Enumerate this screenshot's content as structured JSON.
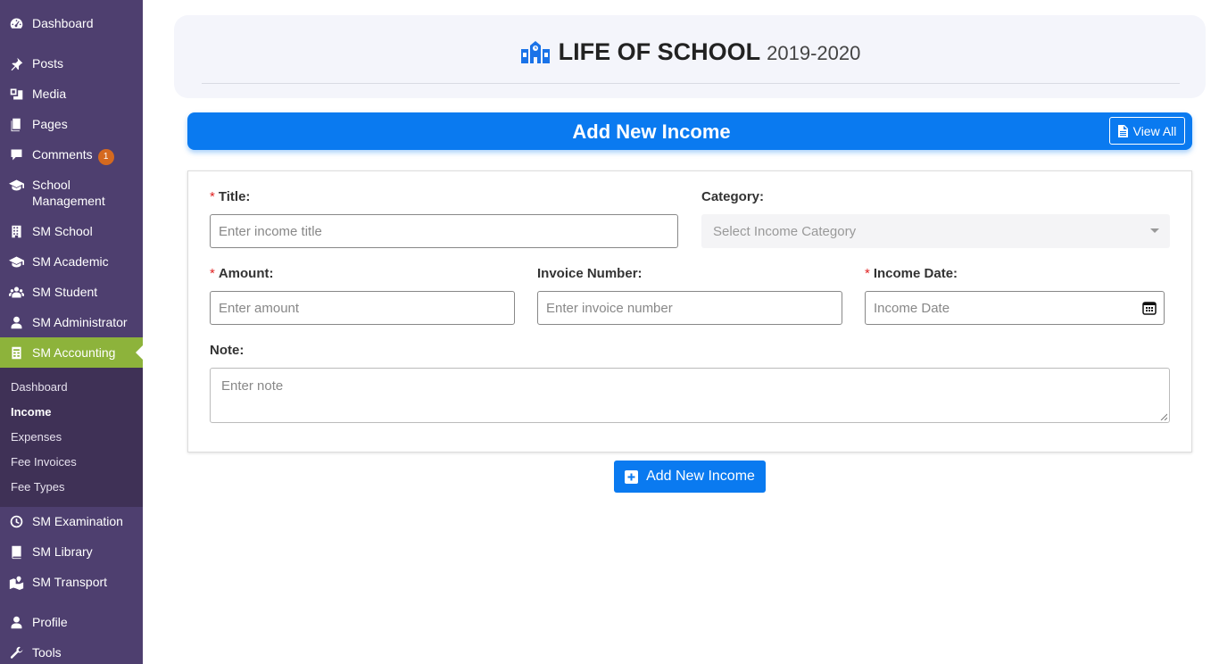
{
  "sidebar": {
    "items": [
      {
        "label": "Dashboard",
        "icon": "dashboard-icon"
      },
      {
        "label": "Posts",
        "icon": "pushpin-icon"
      },
      {
        "label": "Media",
        "icon": "media-icon"
      },
      {
        "label": "Pages",
        "icon": "pages-icon"
      },
      {
        "label": "Comments",
        "icon": "comment-icon",
        "badge": "1"
      },
      {
        "label": "School\nManagement",
        "icon": "graduation-cap-icon"
      },
      {
        "label": "SM School",
        "icon": "building-icon"
      },
      {
        "label": "SM Academic",
        "icon": "graduation-cap-icon"
      },
      {
        "label": "SM Student",
        "icon": "users-icon"
      },
      {
        "label": "SM Administrator",
        "icon": "user-icon"
      },
      {
        "label": "SM Accounting",
        "icon": "spreadsheet-icon"
      },
      {
        "label": "SM Examination",
        "icon": "clock-icon"
      },
      {
        "label": "SM Library",
        "icon": "book-icon"
      },
      {
        "label": "SM Transport",
        "icon": "map-icon"
      },
      {
        "label": "Profile",
        "icon": "user-icon"
      },
      {
        "label": "Tools",
        "icon": "wrench-icon"
      }
    ],
    "submenu": [
      "Dashboard",
      "Income",
      "Expenses",
      "Fee Invoices",
      "Fee Types"
    ],
    "active_color": "#8db33b",
    "bg_color": "#4e3f6f"
  },
  "header": {
    "title": "LIFE OF SCHOOL",
    "year": "2019-2020",
    "icon": "school-icon"
  },
  "banner": {
    "title": "Add New Income",
    "view_all": "View All",
    "color": "#0a7af0"
  },
  "form": {
    "title_label": "Title:",
    "title_placeholder": "Enter income title",
    "category_label": "Category:",
    "category_placeholder": "Select Income Category",
    "amount_label": "Amount:",
    "amount_placeholder": "Enter amount",
    "invoice_label": "Invoice Number:",
    "invoice_placeholder": "Enter invoice number",
    "date_label": "Income Date:",
    "date_placeholder": "Income Date",
    "note_label": "Note:",
    "note_placeholder": "Enter note",
    "required_mark": "*"
  },
  "submit": {
    "label": "Add New Income"
  }
}
